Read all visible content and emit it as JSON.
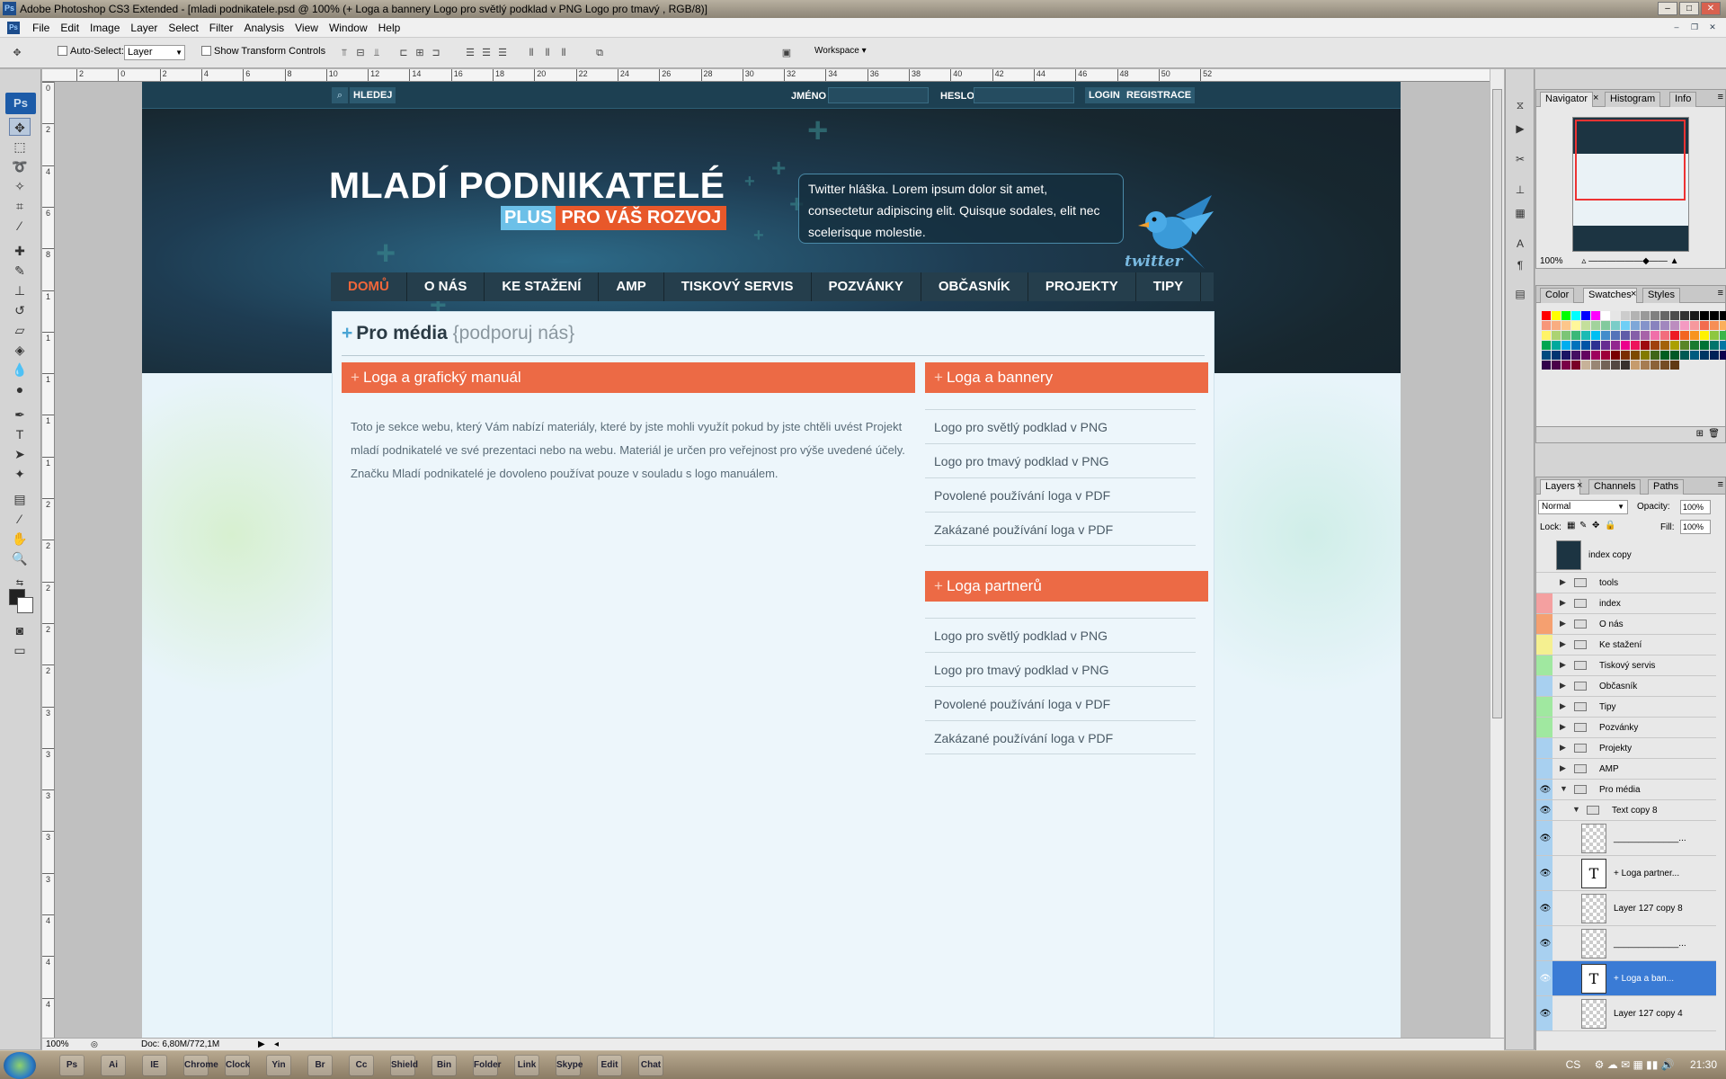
{
  "window": {
    "title": "Adobe Photoshop CS3 Extended - [mladi podnikatele.psd @ 100% (+ Loga a bannery  Logo pro světlý podklad v PNG Logo pro tmavý , RGB/8)]",
    "app_icon": "Ps",
    "controls": [
      "minimize-icon",
      "maximize-icon",
      "close-icon"
    ]
  },
  "menu": {
    "items": [
      "File",
      "Edit",
      "Image",
      "Layer",
      "Select",
      "Filter",
      "Analysis",
      "View",
      "Window",
      "Help"
    ]
  },
  "options": {
    "auto_select_label": "Auto-Select:",
    "auto_select_value": "Layer",
    "show_transform_label": "Show Transform Controls",
    "workspace_label": "Workspace ▾"
  },
  "ruler": {
    "h_labels": [
      "2",
      "0",
      "2",
      "4",
      "6",
      "8",
      "10",
      "12",
      "14",
      "16",
      "18",
      "20",
      "22",
      "24",
      "26",
      "28",
      "30",
      "32",
      "34",
      "36",
      "38",
      "40",
      "42",
      "44",
      "46",
      "48",
      "50",
      "52"
    ],
    "v_labels": [
      "0",
      "2",
      "4",
      "6",
      "8",
      "1",
      "1",
      "1",
      "1",
      "1",
      "2",
      "2",
      "2",
      "2",
      "2",
      "3",
      "3",
      "3",
      "3",
      "3",
      "4",
      "4",
      "4",
      "4"
    ]
  },
  "site": {
    "search_label": "HLEDEJ",
    "jmeno_label": "JMÉNO",
    "heslo_label": "HESLO",
    "login_label": "LOGIN",
    "registrace_label": "REGISTRACE",
    "brand_title": "MLADÍ PODNIKATELÉ",
    "brand_plus": "PLUS",
    "brand_rest": "PRO VÁŠ ROZVOJ",
    "tweet_text": "Twitter hláška. Lorem ipsum dolor sit amet, consectetur adipiscing elit. Quisque sodales, elit nec scelerisque molestie.",
    "twitter_word": "twitter",
    "nav": [
      "DOMŮ",
      "O NÁS",
      "KE STAŽENÍ",
      "AMP",
      "TISKOVÝ SERVIS",
      "POZVÁNKY",
      "OBČASNÍK",
      "PROJEKTY",
      "TIPY"
    ],
    "nav_active_index": 0,
    "page_title_plus": "+",
    "page_title": "Pro média",
    "page_title_sub": "{podporuj nás}",
    "left_box_plus": "+",
    "left_box_title": "Loga a grafický manuál",
    "left_box_text": "Toto je sekce webu, který Vám nabízí materiály, které by jste mohli využít pokud by jste chtěli uvést Projekt mladí podnikatelé ve své prezentaci nebo na webu. Materiál je určen pro veřejnost pro výše uvedené účely. Značku Mladí podnikatelé je dovoleno používat pouze v souladu s logo manuálem.",
    "box1_plus": "+",
    "box1_title": "Loga a bannery",
    "box1_items": [
      "Logo pro světlý podklad v PNG",
      "Logo pro tmavý podklad v PNG",
      "Povolené používání loga v PDF",
      "Zakázané používání loga v PDF"
    ],
    "box2_plus": "+",
    "box2_title": "Loga partnerů",
    "box2_items": [
      "Logo pro světlý podklad v PNG",
      "Logo pro tmavý podklad v PNG",
      "Povolené používání loga v PDF",
      "Zakázané používání loga v PDF"
    ],
    "colors": {
      "header_dark": "#17272f",
      "orange": "#ec6a45",
      "brand_blue": "#6cc0e8",
      "nav_active": "#f0663a"
    }
  },
  "status": {
    "zoom": "100%",
    "doc": "Doc: 6,80M/772,1M"
  },
  "navigator": {
    "tabs": [
      "Navigator",
      "Histogram",
      "Info"
    ],
    "zoom": "100%"
  },
  "swatches": {
    "tabs": [
      "Color",
      "Swatches",
      "Styles"
    ],
    "colors": [
      "#ff0000",
      "#ffff00",
      "#00ff00",
      "#00ffff",
      "#0000ff",
      "#ff00ff",
      "#ffffff",
      "#e6e6e6",
      "#cccccc",
      "#b3b3b3",
      "#999999",
      "#808080",
      "#666666",
      "#4d4d4d",
      "#333333",
      "#1a1a1a",
      "#000000",
      "#000000",
      "#000000",
      "#f7977a",
      "#f9ad81",
      "#fdc68a",
      "#fff79a",
      "#c4df9b",
      "#a2d39c",
      "#82ca9d",
      "#7bcdc8",
      "#6ecff6",
      "#7ea7d8",
      "#8493ca",
      "#8882be",
      "#a187be",
      "#bc8dbf",
      "#f49ac2",
      "#f6989d",
      "#f26c4f",
      "#f68e55",
      "#fbaf5c",
      "#fff467",
      "#acd372",
      "#7cc576",
      "#3bb878",
      "#1abbb4",
      "#00bff3",
      "#438ccb",
      "#5574b9",
      "#605ca8",
      "#855fa8",
      "#a763a8",
      "#f06ea9",
      "#f26d7d",
      "#ed1c24",
      "#f26522",
      "#f7941d",
      "#fff200",
      "#8dc73f",
      "#39b54a",
      "#00a651",
      "#00a99d",
      "#00aeef",
      "#0072bc",
      "#0054a6",
      "#2e3192",
      "#662d91",
      "#92278f",
      "#ec008c",
      "#ed145b",
      "#9e0b0f",
      "#a0410d",
      "#a36209",
      "#aba000",
      "#598527",
      "#197b30",
      "#007236",
      "#00746b",
      "#0076a3",
      "#004b80",
      "#003471",
      "#1b1464",
      "#440e62",
      "#630460",
      "#9e005d",
      "#9e0039",
      "#790000",
      "#7b2e00",
      "#7d4900",
      "#827b00",
      "#406618",
      "#005e20",
      "#005826",
      "#005952",
      "#005b7f",
      "#003663",
      "#002157",
      "#0d004c",
      "#32004b",
      "#4b0049",
      "#7b0046",
      "#7a0026",
      "#c7b299",
      "#998675",
      "#736357",
      "#534741",
      "#37302d",
      "#c69c6d",
      "#a67c52",
      "#8c6239",
      "#754c24",
      "#603913"
    ]
  },
  "layers": {
    "tabs": [
      "Layers",
      "Channels",
      "Paths"
    ],
    "blend": "Normal",
    "opacity_label": "Opacity:",
    "opacity": "100%",
    "lock_label": "Lock:",
    "fill_label": "Fill:",
    "fill": "100%",
    "rows": [
      {
        "name": "index copy",
        "kind": "image",
        "visible": false,
        "color": ""
      },
      {
        "name": "tools",
        "kind": "group",
        "visible": false,
        "color": ""
      },
      {
        "name": "index",
        "kind": "group",
        "visible": false,
        "color": "#f4a0a0"
      },
      {
        "name": "O nás",
        "kind": "group",
        "visible": false,
        "color": "#f5a070"
      },
      {
        "name": "Ke stažení",
        "kind": "group",
        "visible": false,
        "color": "#f5f090"
      },
      {
        "name": "Tiskový servis",
        "kind": "group",
        "visible": false,
        "color": "#a0e8a0"
      },
      {
        "name": "Občasník",
        "kind": "group",
        "visible": false,
        "color": "#a8d0f0"
      },
      {
        "name": "Tipy",
        "kind": "group",
        "visible": false,
        "color": "#a0e8a0"
      },
      {
        "name": "Pozvánky",
        "kind": "group",
        "visible": false,
        "color": "#a0e8a0"
      },
      {
        "name": "Projekty",
        "kind": "group",
        "visible": false,
        "color": "#a8d0f0"
      },
      {
        "name": "AMP",
        "kind": "group",
        "visible": false,
        "color": "#a8d0f0"
      },
      {
        "name": "Pro média",
        "kind": "group-open",
        "visible": true,
        "color": "#a8d0f0"
      },
      {
        "name": "Text copy 8",
        "kind": "subgroup-open",
        "visible": true,
        "color": "#a8d0f0"
      },
      {
        "name": "_____________...",
        "kind": "pixel",
        "visible": true,
        "color": "#a8d0f0"
      },
      {
        "name": "+ Loga partner...",
        "kind": "text",
        "visible": true,
        "color": "#a8d0f0"
      },
      {
        "name": "Layer 127 copy 8",
        "kind": "pixel",
        "visible": true,
        "color": "#a8d0f0"
      },
      {
        "name": "_____________...",
        "kind": "pixel",
        "visible": true,
        "color": "#a8d0f0"
      },
      {
        "name": "+ Loga a ban...",
        "kind": "text",
        "visible": true,
        "color": "#a8d0f0",
        "selected": true
      },
      {
        "name": "Layer 127 copy 4",
        "kind": "pixel",
        "visible": true,
        "color": "#a8d0f0"
      }
    ]
  },
  "taskbar": {
    "apps": [
      "Ps",
      "Ai",
      "IE",
      "Chrome",
      "Clock",
      "Yin",
      "Br",
      "Cc",
      "Shield",
      "Bin",
      "Folder",
      "Link",
      "Skype",
      "Edit",
      "Chat"
    ],
    "lang": "CS",
    "time": "21:30"
  }
}
